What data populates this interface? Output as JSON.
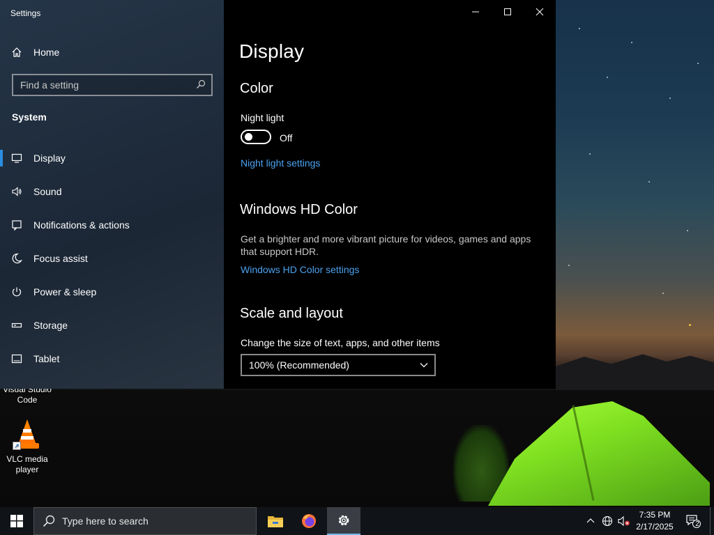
{
  "window": {
    "title": "Settings",
    "controls": {
      "minimize": "minimize",
      "maximize": "maximize",
      "close": "close"
    }
  },
  "sidebar": {
    "home_label": "Home",
    "search_placeholder": "Find a setting",
    "section_heading": "System",
    "items": [
      {
        "label": "Display",
        "icon": "monitor-icon",
        "active": true
      },
      {
        "label": "Sound",
        "icon": "speaker-icon",
        "active": false
      },
      {
        "label": "Notifications & actions",
        "icon": "notification-icon",
        "active": false
      },
      {
        "label": "Focus assist",
        "icon": "moon-icon",
        "active": false
      },
      {
        "label": "Power & sleep",
        "icon": "power-icon",
        "active": false
      },
      {
        "label": "Storage",
        "icon": "storage-icon",
        "active": false
      },
      {
        "label": "Tablet",
        "icon": "tablet-icon",
        "active": false
      }
    ]
  },
  "content": {
    "page_title": "Display",
    "color": {
      "heading": "Color",
      "night_light_label": "Night light",
      "night_light_state": "Off",
      "night_light_on": false,
      "night_light_link": "Night light settings"
    },
    "hd_color": {
      "heading": "Windows HD Color",
      "description": "Get a brighter and more vibrant picture for videos, games and apps that support HDR.",
      "link": "Windows HD Color settings"
    },
    "scale": {
      "heading": "Scale and layout",
      "label": "Change the size of text, apps, and other items",
      "selected": "100% (Recommended)"
    }
  },
  "desktop": {
    "icons": [
      {
        "label": "Visual Studio Code"
      },
      {
        "label": "VLC media player"
      }
    ]
  },
  "taskbar": {
    "search_placeholder": "Type here to search",
    "apps": [
      "file-explorer-icon",
      "firefox-icon",
      "settings-gear-icon"
    ],
    "clock_time": "7:35 PM",
    "clock_date": "2/17/2025",
    "notification_count": "2"
  },
  "colors": {
    "accent": "#2a8de0",
    "link": "#4ba2f0",
    "window_bg": "#000000",
    "taskbar_bg": "#101418"
  }
}
